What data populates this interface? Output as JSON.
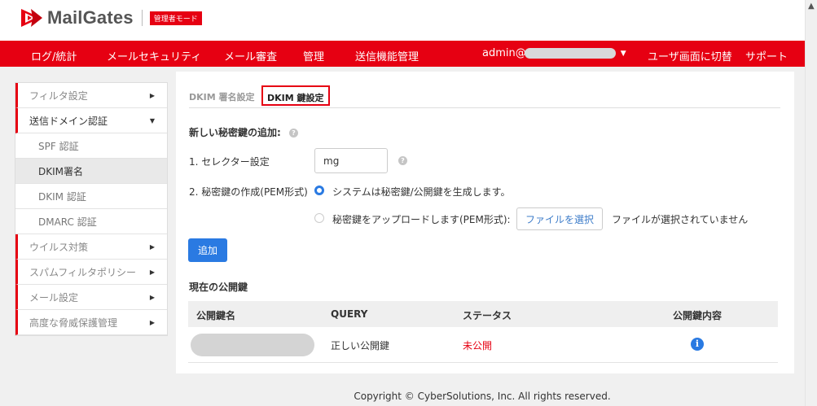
{
  "header": {
    "brand": "MailGates",
    "admin_badge": "管理者モード"
  },
  "nav": {
    "items": [
      "ログ/統計",
      "メールセキュリティ",
      "メール審査",
      "管理",
      "送信機能管理"
    ],
    "user_prefix": "admin@",
    "switch_label": "ユーザ画面に切替",
    "support_label": "サポート"
  },
  "sidebar": {
    "items": [
      {
        "label": "フィルタ設定"
      },
      {
        "label": "送信ドメイン認証"
      },
      {
        "label": "ウイルス対策"
      },
      {
        "label": "スパムフィルタポリシー"
      },
      {
        "label": "メール設定"
      },
      {
        "label": "高度な脅威保護管理"
      }
    ],
    "sub_items": [
      {
        "label": "SPF 認証"
      },
      {
        "label": "DKIM署名"
      },
      {
        "label": "DKIM 認証"
      },
      {
        "label": "DMARC 認証"
      }
    ]
  },
  "main": {
    "tabs": [
      {
        "label": "DKIM 署名設定"
      },
      {
        "label": "DKIM 鍵設定"
      }
    ],
    "add_key_title": "新しい秘密鍵の追加:",
    "selector_label": "1. セレクター設定",
    "selector_value": "mg",
    "privkey_label": "2. 秘密鍵の作成(PEM形式)",
    "option_generate": "システムは秘密鍵/公開鍵を生成します。",
    "option_upload": "秘密鍵をアップロードします(PEM形式):",
    "file_button": "ファイルを選択",
    "file_status": "ファイルが選択されていません",
    "add_button": "追加",
    "current_keys_title": "現在の公開鍵",
    "table": {
      "headers": [
        "公開鍵名",
        "QUERY",
        "ステータス",
        "公開鍵内容"
      ],
      "rows": [
        {
          "query": "正しい公開鍵",
          "status": "未公開"
        }
      ]
    }
  },
  "footer": {
    "copyright": "Copyright © CyberSolutions, Inc. All rights reserved."
  },
  "colors": {
    "brand_red": "#e60012",
    "primary_blue": "#2a7ae2",
    "status_red": "#e60012"
  }
}
